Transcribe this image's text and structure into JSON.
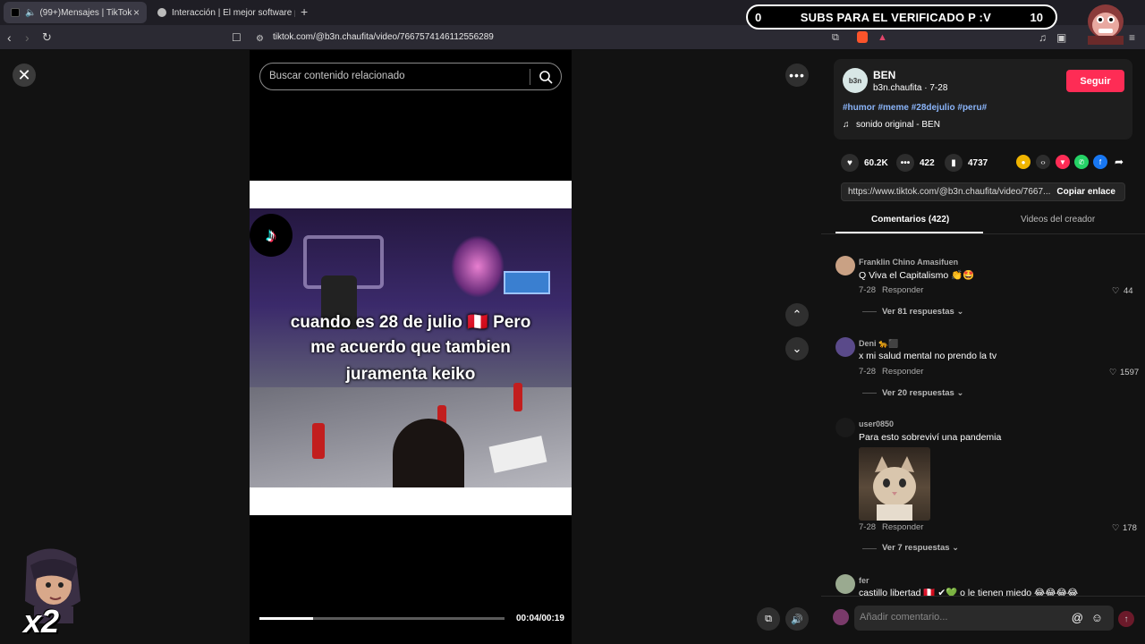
{
  "browser": {
    "tabs": [
      {
        "label": "(99+)Mensajes | TikTok",
        "active": true
      },
      {
        "label": "Interacción | El mejor software para p",
        "active": false
      }
    ],
    "new_tab": "+",
    "url": "tiktok.com/@b3n.chaufita/video/7667574146112556289",
    "close_tab": "×"
  },
  "overlay": {
    "left_count": "0",
    "title": "SUBS PARA EL VERIFICADO P :V",
    "right_count": "10",
    "multiplier": "x2"
  },
  "video": {
    "search_placeholder": "Buscar contenido relacionado",
    "caption_lines": [
      "cuando es 28 de julio 🇵🇪 Pero",
      "me acuerdo que tambien",
      "juramenta keiko"
    ],
    "time": "00:04/00:19",
    "progress": 0.22
  },
  "author": {
    "name": "BEN",
    "avatar_text": "b3n",
    "handle_date": "b3n.chaufita · 7-28",
    "follow": "Seguir",
    "hashtags": "#humor #meme #28dejulio #peru#",
    "sound": "sonido original - BEN"
  },
  "stats": {
    "likes": "60.2K",
    "comments": "422",
    "saves": "4737"
  },
  "link": {
    "url": "https://www.tiktok.com/@b3n.chaufita/video/7667...",
    "copy": "Copiar enlace"
  },
  "tabs": {
    "comments": "Comentarios (422)",
    "creator": "Videos del creador"
  },
  "comments": [
    {
      "user": "Franklin Chino Amasifuen",
      "text": "Q Viva el Capitalismo 👏🤩",
      "date": "7-28",
      "reply": "Responder",
      "likes": "44",
      "replies": "Ver 81 respuestas ⌄"
    },
    {
      "user": "Deni 🐆⬛",
      "text": "x mi salud mental no prendo la tv",
      "date": "7-28",
      "reply": "Responder",
      "likes": "1597",
      "replies": "Ver 20 respuestas ⌄"
    },
    {
      "user": "user0850",
      "text": "Para esto sobreviví una pandemia",
      "date": "7-28",
      "reply": "Responder",
      "likes": "178",
      "replies": "Ver 7 respuestas ⌄"
    },
    {
      "user": "fer",
      "text": "castillo libertad 🇵🇪 ✔💚 o le tienen miedo 😂😂😂😂"
    }
  ],
  "comment_input": {
    "placeholder": "Añadir comentario..."
  },
  "colors": {
    "accent": "#fe2c55",
    "background": "#121212",
    "chrome": "#2b2a33"
  }
}
